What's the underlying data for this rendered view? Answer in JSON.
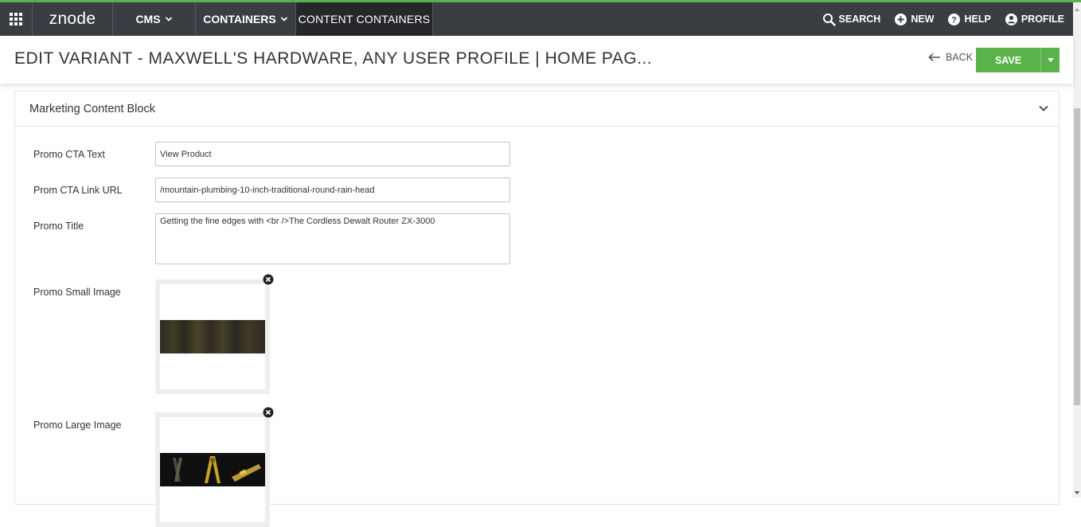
{
  "topbar": {
    "logo": "znode",
    "nav": [
      "CMS",
      "CONTAINERS",
      "CONTENT CONTAINERS"
    ],
    "actions": {
      "search": "SEARCH",
      "new": "NEW",
      "help": "HELP",
      "profile": "PROFILE"
    }
  },
  "header": {
    "title": "EDIT VARIANT  - MAXWELL'S HARDWARE, ANY USER PROFILE | HOME PAG...",
    "back": "BACK",
    "save": "SAVE"
  },
  "panel": {
    "title": "Marketing Content Block",
    "fields": {
      "promo_cta_text": {
        "label": "Promo CTA Text",
        "value": "View Product"
      },
      "promo_cta_link": {
        "label": "Prom CTA Link URL",
        "value": "/mountain-plumbing-10-inch-traditional-round-rain-head"
      },
      "promo_title": {
        "label": "Promo Title",
        "value": "Getting the fine edges with <br />The Cordless Dewalt Router ZX-3000"
      },
      "promo_small_image": {
        "label": "Promo Small Image"
      },
      "promo_large_image": {
        "label": "Promo Large Image"
      }
    }
  },
  "colors": {
    "accent": "#5bb14a",
    "topbar": "#3a3d42",
    "active_tab": "#25272a"
  },
  "icons": [
    "apps-grid-icon",
    "chevron-down-icon",
    "search-icon",
    "plus-circle-icon",
    "help-circle-icon",
    "user-circle-icon",
    "arrow-left-icon",
    "close-circle-icon"
  ]
}
